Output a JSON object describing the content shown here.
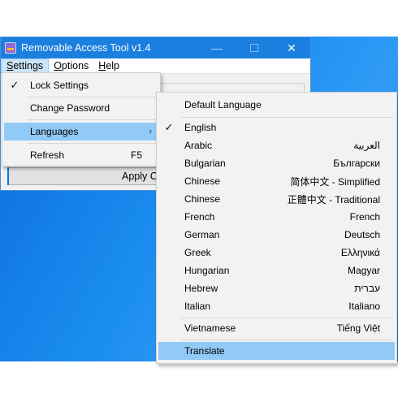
{
  "window": {
    "title": "Removable Access Tool v1.4",
    "minimize_glyph": "—",
    "close_glyph": "✕"
  },
  "menubar": {
    "items": [
      {
        "label": "Settings",
        "mnemonic": "S"
      },
      {
        "label": "Options",
        "mnemonic": "O"
      },
      {
        "label": "Help",
        "mnemonic": "H"
      }
    ]
  },
  "apply_button_label": "Apply C",
  "settings_menu": {
    "items": [
      {
        "label": "Lock Settings",
        "checked": true
      },
      {
        "label": "Change Password"
      },
      {
        "label": "Languages",
        "submenu": true,
        "highlighted": true
      },
      {
        "label": "Refresh",
        "shortcut": "F5"
      }
    ],
    "check_glyph": "✓",
    "submenu_arrow": "›"
  },
  "languages_menu": {
    "header": "Default Language",
    "languages": [
      {
        "name": "English",
        "native": "",
        "checked": true
      },
      {
        "name": "Arabic",
        "native": "العربية"
      },
      {
        "name": "Bulgarian",
        "native": "Български"
      },
      {
        "name": "Chinese",
        "native": "简体中文 - Simplified"
      },
      {
        "name": "Chinese",
        "native": "正體中文 - Traditional"
      },
      {
        "name": "French",
        "native": "French"
      },
      {
        "name": "German",
        "native": "Deutsch"
      },
      {
        "name": "Greek",
        "native": "Ελληνικά"
      },
      {
        "name": "Hungarian",
        "native": "Magyar"
      },
      {
        "name": "Hebrew",
        "native": "עברית"
      },
      {
        "name": "Italian",
        "native": "Italiano"
      },
      {
        "name": "Vietnamese",
        "native": "Tiếng Việt"
      }
    ],
    "translate": "Translate"
  },
  "colors": {
    "titlebar": "#1b7fe0",
    "menu_highlight": "#91c9f7",
    "desktop": "#1a8cf0"
  }
}
